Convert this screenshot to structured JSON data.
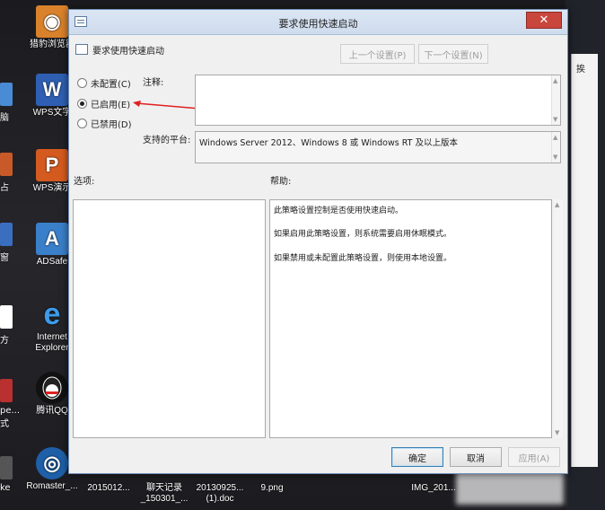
{
  "dialog": {
    "title": "要求使用快速启动",
    "setting_name": "要求使用快速启动",
    "prev_setting": "上一个设置(P)",
    "next_setting": "下一个设置(N)",
    "radio_not_configured": "未配置(C)",
    "radio_enabled": "已启用(E)",
    "radio_disabled": "已禁用(D)",
    "selected_state": "enabled",
    "comment_label": "注释:",
    "comment_value": "",
    "platform_label": "支持的平台:",
    "platform_value": "Windows Server 2012、Windows 8 或 Windows RT 及以上版本",
    "options_label": "选项:",
    "help_label": "帮助:",
    "help_lines": [
      "此策略设置控制是否使用快速启动。",
      "如果启用此策略设置，则系统需要启用休眠模式。",
      "如果禁用或未配置此策略设置，则使用本地设置。"
    ],
    "ok_button": "确定",
    "cancel_button": "取消",
    "apply_button": "应用(A)"
  },
  "desktop": {
    "icons": [
      {
        "label": "猎豹浏览器",
        "icon": "browser-icon",
        "color": "#d9822b"
      },
      {
        "label": "WPS文字",
        "icon": "wps-writer-icon",
        "color": "#2f5fb3"
      },
      {
        "label": "WPS演示",
        "icon": "wps-presentation-icon",
        "color": "#d45a1f"
      },
      {
        "label": "ADSafe",
        "icon": "adsafe-icon",
        "color": "#3a7fc9"
      },
      {
        "label": "Internet Explorer",
        "icon": "internet-explorer-icon",
        "color": "#2b7fd6"
      },
      {
        "label": "腾讯QQ",
        "icon": "qq-icon",
        "color": "#111111"
      },
      {
        "label": "Romaster_...",
        "icon": "romaster-icon",
        "color": "#2a7ad0"
      }
    ],
    "bottom_files": [
      "2015012...",
      "聊天记录_150301_...",
      "20130925... (1).doc",
      "9.png",
      "IMG_201..."
    ],
    "left_cut_labels": [
      "脑",
      "占",
      "窗",
      "方",
      "pe...",
      "式",
      "ke"
    ],
    "right_cut_label": "挨"
  }
}
